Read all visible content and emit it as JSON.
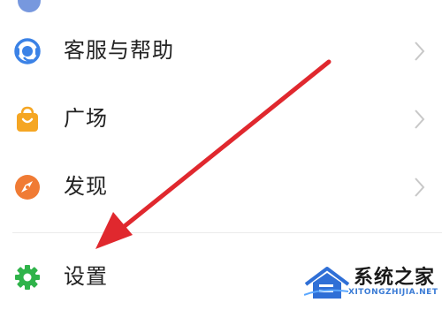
{
  "menu": {
    "items": [
      {
        "label": "客服与帮助",
        "icon": "headset-icon",
        "color": "#3b82e6"
      },
      {
        "label": "广场",
        "icon": "shopping-bag-icon",
        "color": "#f5a623"
      },
      {
        "label": "发现",
        "icon": "compass-icon",
        "color": "#f07b34"
      },
      {
        "label": "设置",
        "icon": "gear-icon",
        "color": "#2fb34a"
      }
    ]
  },
  "annotation": {
    "color": "#e0282e"
  },
  "watermark": {
    "title": "系统之家",
    "subtitle": "XITONGZHIJIA.NET"
  }
}
